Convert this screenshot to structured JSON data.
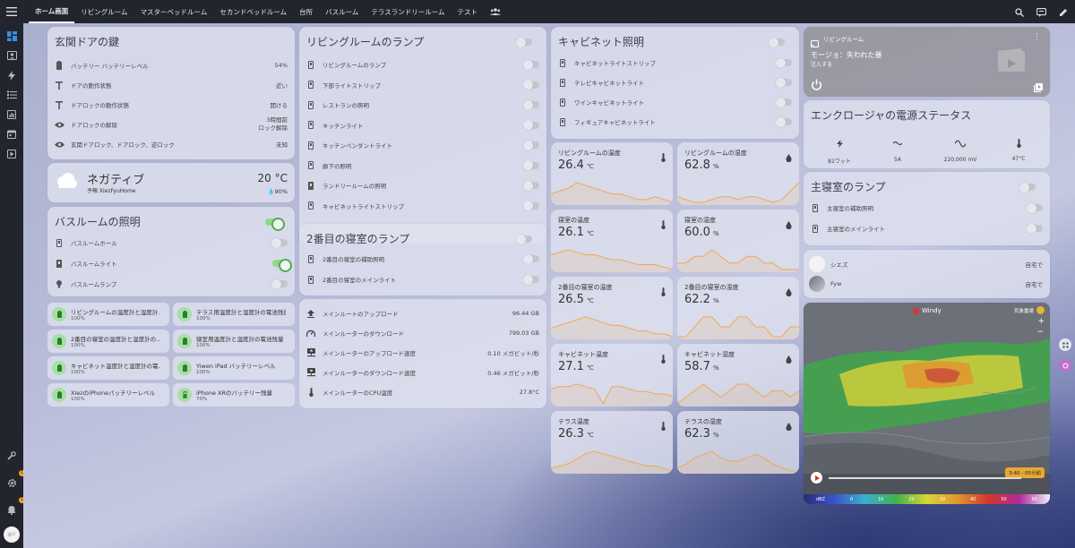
{
  "colors": {
    "accent": "#4caf50",
    "chart_line": "#f0a850",
    "topbar": "#22252d"
  },
  "tabs": [
    "ホーム画面",
    "リビングルーム",
    "マスターベッドルーム",
    "セカンドベッドルーム",
    "台所",
    "バスルーム",
    "テラスランドリールーム",
    "テスト"
  ],
  "front_door": {
    "title": "玄関ドアの鍵",
    "rows": [
      {
        "label": "バッテリー バッテリーレベル",
        "value": "54%"
      },
      {
        "label": "ドアの動作状態",
        "value": "近い"
      },
      {
        "label": "ドアロックの動作状態",
        "value": "開ける"
      },
      {
        "label": "ドアロックの解除",
        "value": "3時間前",
        "value2": "ロック解除"
      },
      {
        "label": "玄関ドアロック、ドアロック、逆ロック",
        "value": "未知"
      }
    ]
  },
  "weather": {
    "state": "ネガティブ",
    "forecast": "予報 XiezFyuHome",
    "temp": "20 °C",
    "humidity": "90%"
  },
  "bathroom": {
    "title": "バスルームの照明",
    "rows": [
      {
        "label": "バスルームホール",
        "on": false
      },
      {
        "label": "バスルームライト",
        "on": true
      },
      {
        "label": "バスルームランプ",
        "on": false
      }
    ]
  },
  "batteries": [
    {
      "name": "リビングルームの温度計と湿度計...",
      "level": "100%"
    },
    {
      "name": "テラス用温度計と湿度計の電池残量",
      "level": "100%"
    },
    {
      "name": "2番目の寝室の温度計と湿度計の...",
      "level": "100%"
    },
    {
      "name": "寝室用温度計と湿度計の電池残量",
      "level": "100%"
    },
    {
      "name": "キャビネット温度計と湿度計の電...",
      "level": "100%"
    },
    {
      "name": "Yiwen iPad バッテリーレベル",
      "level": "100%"
    },
    {
      "name": "XiezのiPhoneバッテリーレベル",
      "level": "100%"
    },
    {
      "name": "iPhone XRのバッテリー残量",
      "level": "70%"
    }
  ],
  "living_lamps": {
    "title": "リビングルームのランプ",
    "rows": [
      "リビングルームのランプ",
      "下部ライトストリップ",
      "レストランの照明",
      "キッチンライト",
      "キッチンペンダントライト",
      "廊下の照明",
      "ランドリールームの照明",
      "キャビネットライトストリップ"
    ]
  },
  "second_bedroom": {
    "title": "2番目の寝室のランプ",
    "rows": [
      "2番目の寝室の補助照明",
      "2番目の寝室のメインライト"
    ]
  },
  "router": {
    "rows": [
      {
        "label": "メインルートのアップロード",
        "value": "96.44 GB"
      },
      {
        "label": "メインルーターのダウンロード",
        "value": "799.03 GB"
      },
      {
        "label": "メインルーターのアップロード速度",
        "value": "0.10 メガビット/秒"
      },
      {
        "label": "メインルーターのダウンロード速度",
        "value": "0.46 メガビット/秒"
      },
      {
        "label": "メインルーターのCPU温度",
        "value": "27.8°C"
      }
    ]
  },
  "cabinet": {
    "title": "キャビネット照明",
    "rows": [
      "キャビネットライトストリップ",
      "テレビキャビネットライト",
      "ワインキャビネットライト",
      "フィギュアキャビネットライト"
    ]
  },
  "sensors": [
    {
      "name": "リビングルームの温度",
      "value": "26.4",
      "unit": "℃",
      "icon": "thermometer-icon",
      "spark": [
        8,
        9,
        10,
        12,
        11,
        10,
        9,
        8,
        8,
        7,
        6,
        6,
        7,
        6,
        5
      ]
    },
    {
      "name": "リビングルームの湿度",
      "value": "62.8",
      "unit": "%",
      "icon": "water-icon",
      "spark": [
        7,
        6,
        5,
        5,
        6,
        7,
        7,
        6,
        7,
        7,
        6,
        5,
        6,
        9,
        12
      ]
    },
    {
      "name": "寝室の温度",
      "value": "26.1",
      "unit": "℃",
      "icon": "thermometer-icon",
      "spark": [
        9,
        10,
        11,
        10,
        9,
        9,
        8,
        7,
        7,
        6,
        5,
        5,
        5,
        4,
        3
      ]
    },
    {
      "name": "寝室の湿度",
      "value": "60.0",
      "unit": "%",
      "icon": "water-icon",
      "spark": [
        6,
        6,
        7,
        7,
        8,
        7,
        6,
        6,
        7,
        7,
        6,
        6,
        5,
        5,
        5
      ]
    },
    {
      "name": "2番目の寝室の温度",
      "value": "26.5",
      "unit": "℃",
      "icon": "thermometer-icon",
      "spark": [
        8,
        9,
        10,
        11,
        12,
        11,
        10,
        9,
        9,
        8,
        7,
        7,
        6,
        6,
        5
      ]
    },
    {
      "name": "2番目の寝室の湿度",
      "value": "62.2",
      "unit": "%",
      "icon": "water-icon",
      "spark": [
        5,
        5,
        6,
        7,
        7,
        6,
        6,
        7,
        7,
        6,
        6,
        5,
        5,
        6,
        6
      ]
    },
    {
      "name": "キャビネット温度",
      "value": "27.1",
      "unit": "℃",
      "icon": "thermometer-icon",
      "spark": [
        8,
        9,
        9,
        10,
        9,
        8,
        2,
        9,
        9,
        8,
        7,
        7,
        6,
        6,
        5
      ]
    },
    {
      "name": "キャビネット湿度",
      "value": "58.7",
      "unit": "%",
      "icon": "water-icon",
      "spark": [
        4,
        5,
        6,
        7,
        6,
        5,
        6,
        7,
        7,
        6,
        5,
        6,
        6,
        5,
        6
      ]
    },
    {
      "name": "テラス温度",
      "value": "26.3",
      "unit": "℃",
      "icon": "thermometer-icon",
      "spark": [
        5,
        6,
        7,
        9,
        11,
        12,
        11,
        10,
        9,
        8,
        7,
        6,
        6,
        5,
        4
      ]
    },
    {
      "name": "テラスの湿度",
      "value": "62.3",
      "unit": "%",
      "icon": "water-icon",
      "spark": [
        6,
        7,
        9,
        10,
        11,
        9,
        8,
        8,
        9,
        10,
        9,
        7,
        6,
        5,
        5
      ]
    }
  ],
  "media": {
    "source": "リビングルーム",
    "title": "モージョ：失われた暴",
    "subtitle": "注入する"
  },
  "power": {
    "title": "エンクロージャの電源ステータス",
    "items": [
      {
        "icon": "flash-icon",
        "value": "81ワット"
      },
      {
        "icon": "current-icon",
        "value": "5A"
      },
      {
        "icon": "sine-wave-icon",
        "value": "220,000 mV"
      },
      {
        "icon": "thermometer-icon",
        "value": "47°C"
      }
    ]
  },
  "master_lamps": {
    "title": "主寝室のランプ",
    "rows": [
      "主寝室の補助照明",
      "主寝室のメインライト"
    ]
  },
  "persons": [
    {
      "name": "シエズ",
      "state": "自宅で"
    },
    {
      "name": "Fyw",
      "state": "自宅で"
    }
  ],
  "map": {
    "brand": "Windy",
    "layer": "気象雷達",
    "time": "3:40 - 05分前",
    "scale_unit": "dBZ",
    "scale": [
      "0",
      "10",
      "20",
      "30",
      "40",
      "50",
      "60"
    ]
  }
}
